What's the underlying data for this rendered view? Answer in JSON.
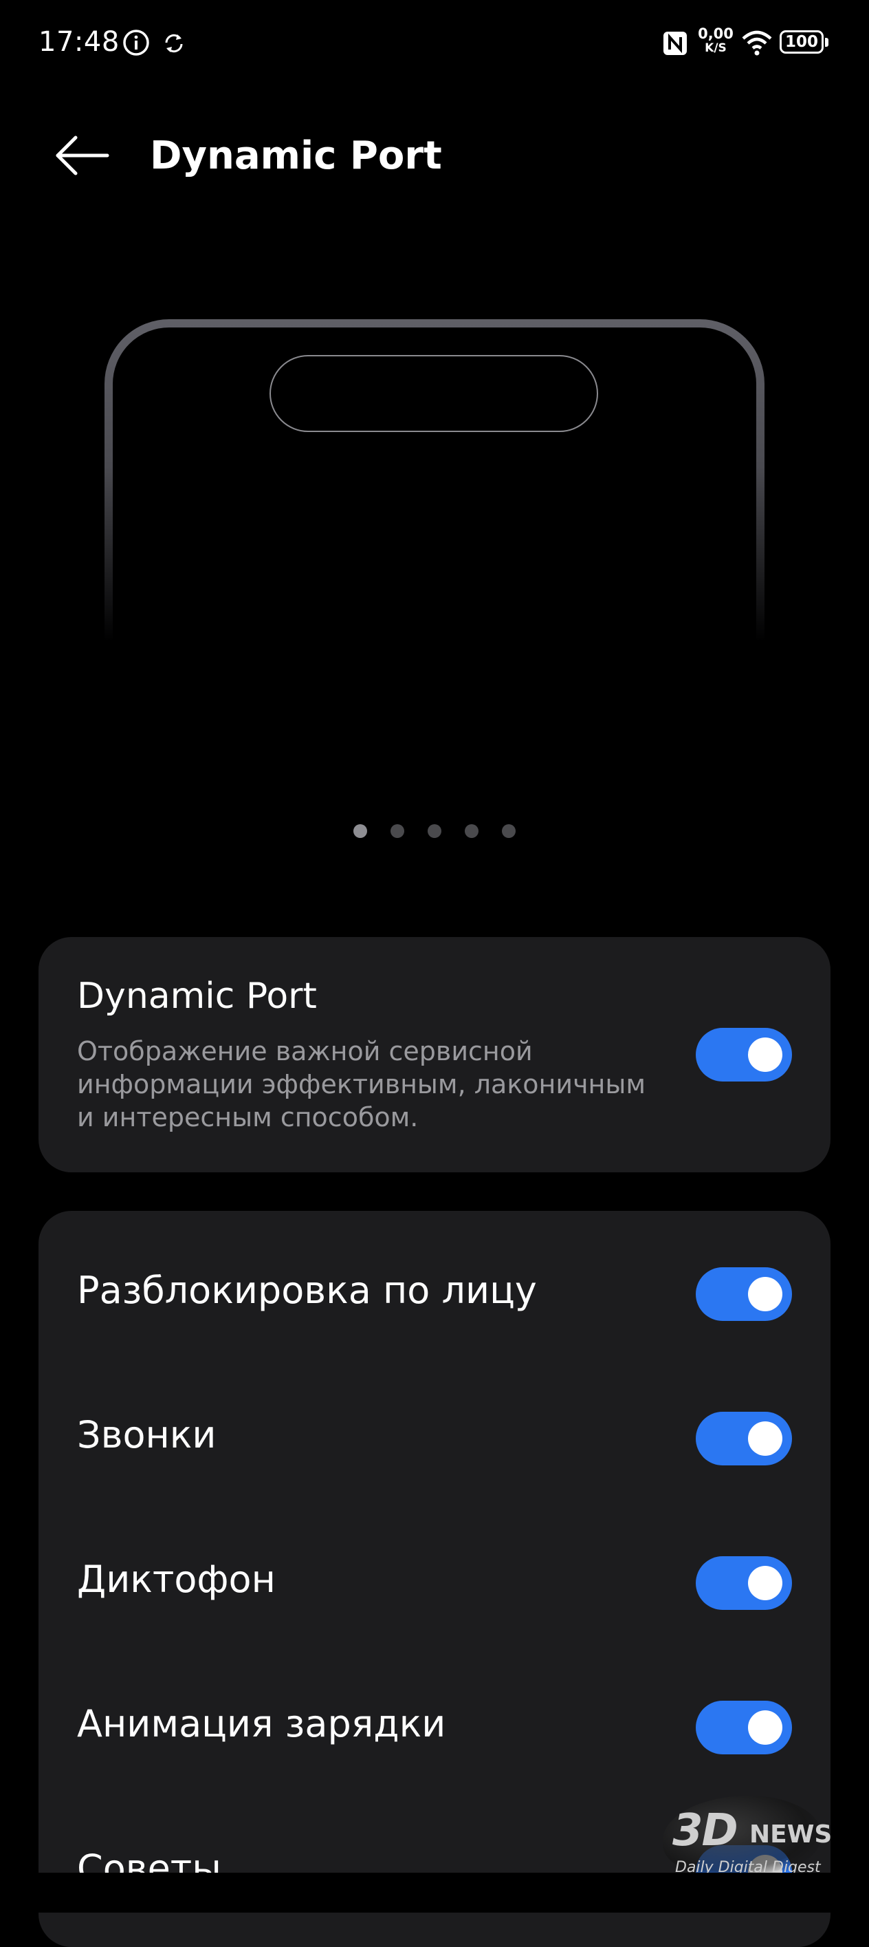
{
  "status_bar": {
    "time": "17:48",
    "net_speed_value": "0,00",
    "net_speed_unit": "K/S",
    "battery_level": "100",
    "icons": [
      "info-icon",
      "sync-icon",
      "nfc-icon",
      "wifi-icon",
      "battery-icon"
    ]
  },
  "header": {
    "title": "Dynamic Port",
    "back_icon": "arrow-left-icon"
  },
  "pager": {
    "count": 5,
    "active_index": 0
  },
  "main_setting": {
    "title": "Dynamic Port",
    "description": "Отображение важной сервисной информации эффективным, лаконичным и интересным способом.",
    "enabled": true
  },
  "settings": [
    {
      "label": "Разблокировка по лицу",
      "enabled": true
    },
    {
      "label": "Звонки",
      "enabled": true
    },
    {
      "label": "Диктофон",
      "enabled": true
    },
    {
      "label": "Анимация зарядки",
      "enabled": true
    },
    {
      "label": "Советы",
      "enabled": true
    }
  ],
  "watermark": {
    "logo": "3D",
    "news": "NEWS",
    "tagline": "Daily Digital Digest"
  },
  "colors": {
    "background": "#000000",
    "card": "#1c1c1e",
    "accent": "#2b77f2",
    "secondary_text": "#9a9a9e"
  }
}
